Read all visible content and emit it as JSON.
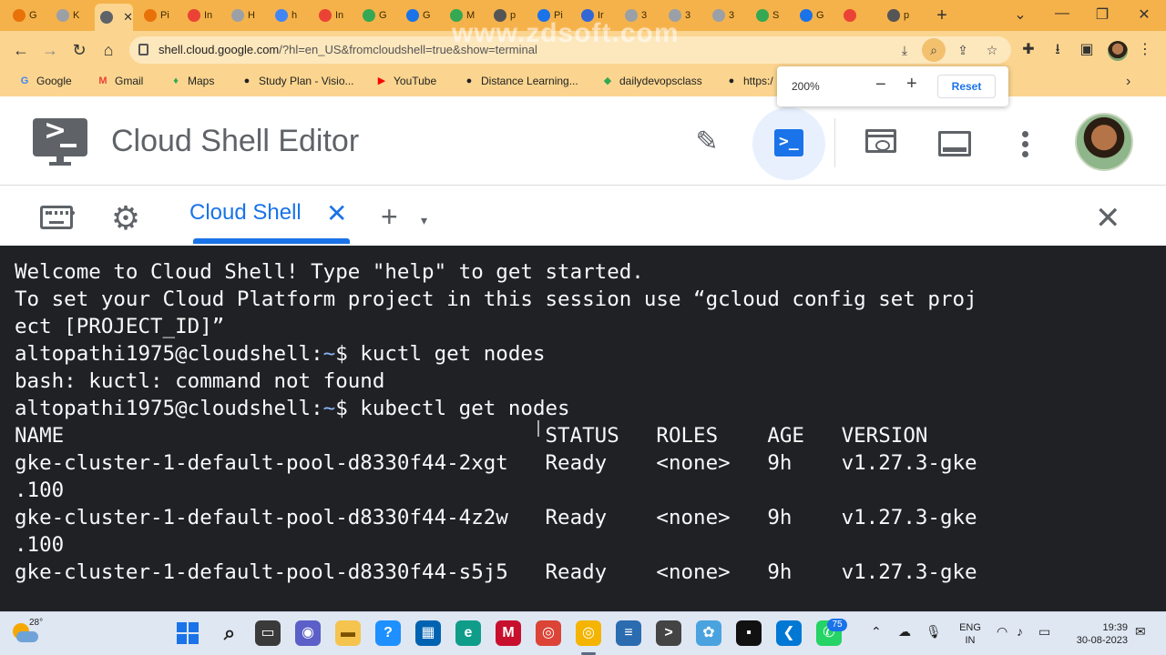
{
  "browser": {
    "tabs": [
      {
        "label": "G",
        "color": "#e8710a"
      },
      {
        "label": "K",
        "color": "#9aa0a6"
      },
      {
        "label": "",
        "color": "#5f6368",
        "active": true
      },
      {
        "label": "Pi",
        "color": "#e8710a"
      },
      {
        "label": "In",
        "color": "#ea4335"
      },
      {
        "label": "H",
        "color": "#9aa0a6"
      },
      {
        "label": "h",
        "color": "#4285f4"
      },
      {
        "label": "In",
        "color": "#ea4335"
      },
      {
        "label": "G",
        "color": "#34a853"
      },
      {
        "label": "G",
        "color": "#1a73e8"
      },
      {
        "label": "M",
        "color": "#34a853"
      },
      {
        "label": "p",
        "color": "#555555"
      },
      {
        "label": "Pi",
        "color": "#1a73e8"
      },
      {
        "label": "Ir",
        "color": "#3367d6"
      },
      {
        "label": "3",
        "color": "#9aa0a6"
      },
      {
        "label": "3",
        "color": "#9aa0a6"
      },
      {
        "label": "3",
        "color": "#9aa0a6"
      },
      {
        "label": "S",
        "color": "#34a853"
      },
      {
        "label": "G",
        "color": "#1a73e8"
      },
      {
        "label": "",
        "color": "#ea4335"
      },
      {
        "label": "p",
        "color": "#555555"
      }
    ],
    "address": {
      "host": "shell.cloud.google.com",
      "path": "/?hl=en_US&fromcloudshell=true&show=terminal"
    },
    "bookmarks": [
      {
        "label": "Google",
        "icon": "G",
        "color": "#4285f4"
      },
      {
        "label": "Gmail",
        "icon": "M",
        "color": "#ea4335"
      },
      {
        "label": "Maps",
        "icon": "♦",
        "color": "#34a853"
      },
      {
        "label": "Study Plan - Visio...",
        "icon": "●",
        "color": "#202124"
      },
      {
        "label": "YouTube",
        "icon": "▶",
        "color": "#ff0000"
      },
      {
        "label": "Distance Learning...",
        "icon": "●",
        "color": "#202124"
      },
      {
        "label": "dailydevopsclass",
        "icon": "◆",
        "color": "#34a853"
      },
      {
        "label": "https:/",
        "icon": "●",
        "color": "#202124"
      }
    ],
    "zoom_popup": {
      "level": "200%",
      "minus": "−",
      "plus": "+",
      "reset": "Reset"
    }
  },
  "header": {
    "title": "Cloud Shell Editor"
  },
  "tabbar": {
    "tab_label": "Cloud Shell",
    "close_glyph": "✕",
    "add_glyph": "+",
    "dropdown_glyph": "▾",
    "close_panel_glyph": "✕"
  },
  "terminal": {
    "lines": [
      {
        "text": "Welcome to Cloud Shell! Type \"help\" to get started."
      },
      {
        "text": "To set your Cloud Platform project in this session use “gcloud config set proj"
      },
      {
        "text": "ect [PROJECT_ID]”"
      },
      {
        "prompt": "altopathi1975@cloudshell:",
        "tilde": "~",
        "cmd": "$ kuctl get nodes"
      },
      {
        "text": "bash: kuctl: command not found"
      },
      {
        "prompt": "altopathi1975@cloudshell:",
        "tilde": "~",
        "cmd": "$ kubectl get nodes"
      },
      {
        "text": "NAME                                       STATUS   ROLES    AGE   VERSION"
      },
      {
        "text": "gke-cluster-1-default-pool-d8330f44-2xgt   Ready    <none>   9h    v1.27.3-gke"
      },
      {
        "text": ".100"
      },
      {
        "text": "gke-cluster-1-default-pool-d8330f44-4z2w   Ready    <none>   9h    v1.27.3-gke"
      },
      {
        "text": ".100"
      },
      {
        "text": "gke-cluster-1-default-pool-d8330f44-s5j5   Ready    <none>   9h    v1.27.3-gke"
      }
    ]
  },
  "taskbar": {
    "temperature": "28°",
    "notification_count": "75",
    "lang_line1": "ENG",
    "lang_line2": "IN",
    "time": "19:39",
    "date": "30-08-2023"
  },
  "watermark": "www.zdsoft.com"
}
